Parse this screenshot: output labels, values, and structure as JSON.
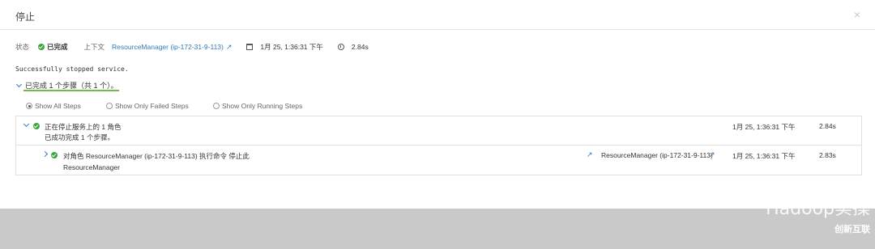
{
  "dialog": {
    "title": "停止",
    "close_label": "×"
  },
  "status_bar": {
    "status_label": "状态",
    "status_value": "已完成",
    "context_label": "上下文",
    "context_link": "ResourceManager (ip-172-31-9-113)",
    "date": "1月 25, 1:36:31 下午",
    "duration": "2.84s"
  },
  "message": "Successfully stopped service.",
  "summary": "已完成 1 个步骤（共 1 个）。",
  "filters": [
    {
      "label": "Show All Steps",
      "selected": true
    },
    {
      "label": "Show Only Failed Steps",
      "selected": false
    },
    {
      "label": "Show Only Running Steps",
      "selected": false
    }
  ],
  "steps": [
    {
      "title": "正在停止服务上的 1 角色",
      "subtitle": "已成功完成 1 个步骤。",
      "date": "1月 25, 1:36:31 下午",
      "duration": "2.84s"
    },
    {
      "title": "对角色 ResourceManager (ip-172-31-9-113) 执行命令 停止此",
      "subtitle": "ResourceManager",
      "link": "ResourceManager (ip-172-31-9-113)",
      "date": "1月 25, 1:36:31 下午",
      "duration": "2.83s"
    }
  ],
  "watermark": {
    "text": "Hadoop实操",
    "brand": "创新互联"
  },
  "colors": {
    "success": "#3aa53a",
    "link": "#337ab7",
    "highlight": "#6bbf45"
  }
}
